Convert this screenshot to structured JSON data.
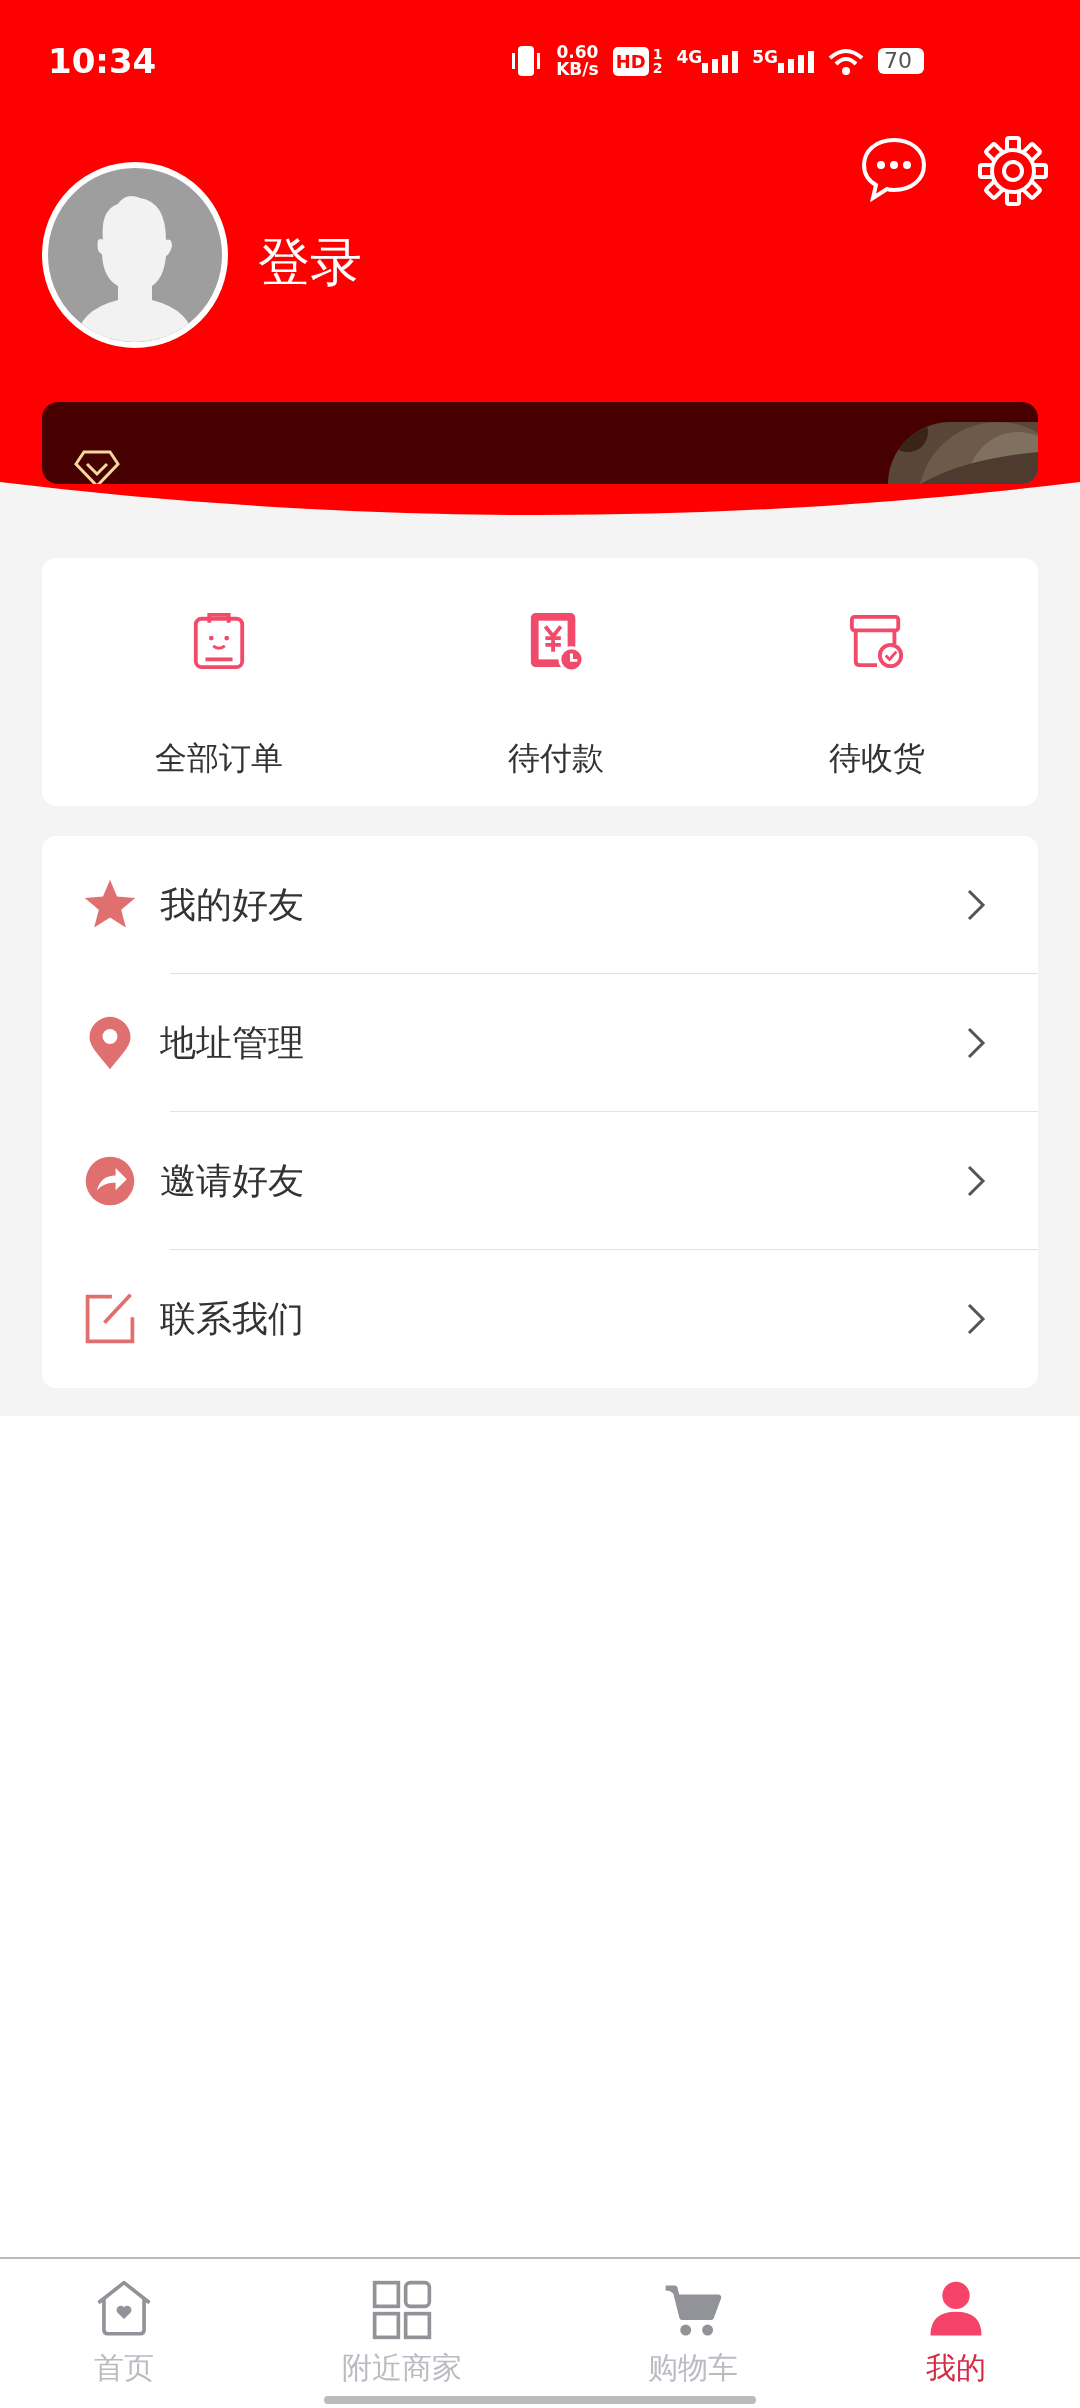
{
  "status_bar": {
    "time": "10:34",
    "speed": "0.60",
    "speed_unit": "KB/s",
    "hd": "HD",
    "sim_1": "1",
    "sim_2": "2",
    "net_1": "4G",
    "net_2": "5G",
    "battery": "70"
  },
  "header": {
    "login": "登录"
  },
  "orders": [
    {
      "kind": "clipboard",
      "label": "全部订单"
    },
    {
      "kind": "bill",
      "label": "待付款"
    },
    {
      "kind": "box",
      "label": "待收货"
    }
  ],
  "menu": [
    {
      "kind": "star",
      "label": "我的好友"
    },
    {
      "kind": "pin",
      "label": "地址管理"
    },
    {
      "kind": "share",
      "label": "邀请好友"
    },
    {
      "kind": "edit",
      "label": "联系我们"
    }
  ],
  "tabs": [
    {
      "kind": "home",
      "label": "首页",
      "selected": false
    },
    {
      "kind": "grid",
      "label": "附近商家",
      "selected": false
    },
    {
      "kind": "cart",
      "label": "购物车",
      "selected": false
    },
    {
      "kind": "user",
      "label": "我的",
      "selected": true
    }
  ]
}
